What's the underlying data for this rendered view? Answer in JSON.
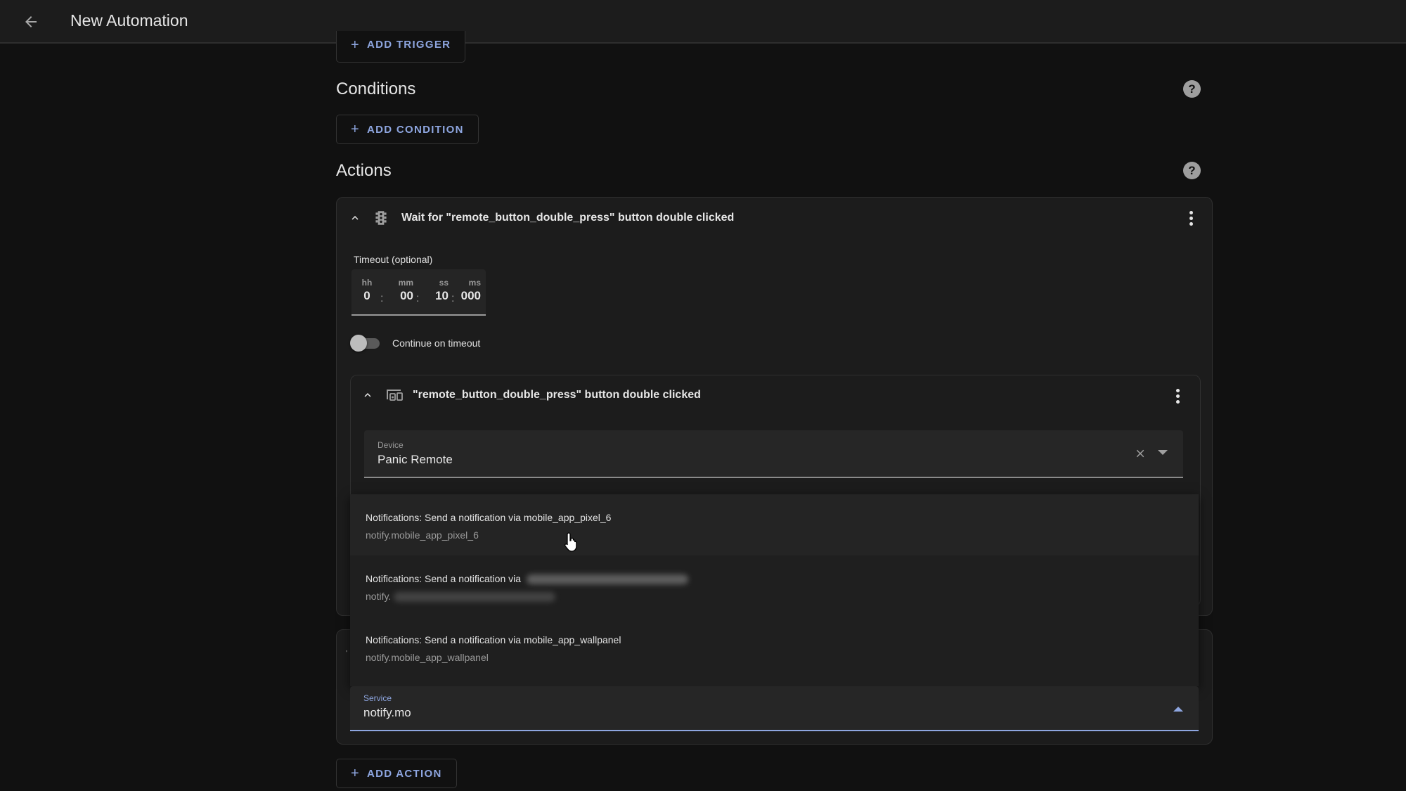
{
  "app_bar": {
    "title": "New Automation",
    "back_icon": "arrow-left-icon"
  },
  "triggers": {
    "add_label": "ADD TRIGGER"
  },
  "conditions": {
    "title": "Conditions",
    "add_label": "ADD CONDITION",
    "help_icon": "?"
  },
  "actions": {
    "title": "Actions",
    "help_icon": "?",
    "add_label": "ADD ACTION",
    "wait_card": {
      "title": "Wait for \"remote_button_double_press\" button double clicked",
      "icon": "traffic-light-icon",
      "timeout": {
        "label": "Timeout (optional)",
        "units": [
          "hh",
          "mm",
          "ss",
          "ms"
        ],
        "values": [
          "0",
          "00",
          "10",
          "000"
        ],
        "separator": ":"
      },
      "continue_on_timeout": {
        "label": "Continue on timeout",
        "checked": false
      },
      "trigger_card": {
        "title": "\"remote_button_double_press\" button double clicked",
        "icon": "devices-icon",
        "device_field": {
          "label": "Device",
          "value": "Panic Remote"
        }
      }
    },
    "service_card": {
      "service_field": {
        "label": "Service",
        "value": "notify.mo"
      },
      "dropdown": {
        "items": [
          {
            "primary": "Notifications: Send a notification via mobile_app_pixel_6",
            "secondary": "notify.mobile_app_pixel_6",
            "redacted": false
          },
          {
            "primary": "Notifications: Send a notification via",
            "secondary": "notify.",
            "redacted": true
          },
          {
            "primary": "Notifications: Send a notification via mobile_app_wallpanel",
            "secondary": "notify.mobile_app_wallpanel",
            "redacted": false
          }
        ]
      }
    }
  },
  "colors": {
    "accent": "#8ea6e0",
    "background": "#111111",
    "card": "#1c1c1c",
    "app_bar": "#1c1c1c"
  }
}
